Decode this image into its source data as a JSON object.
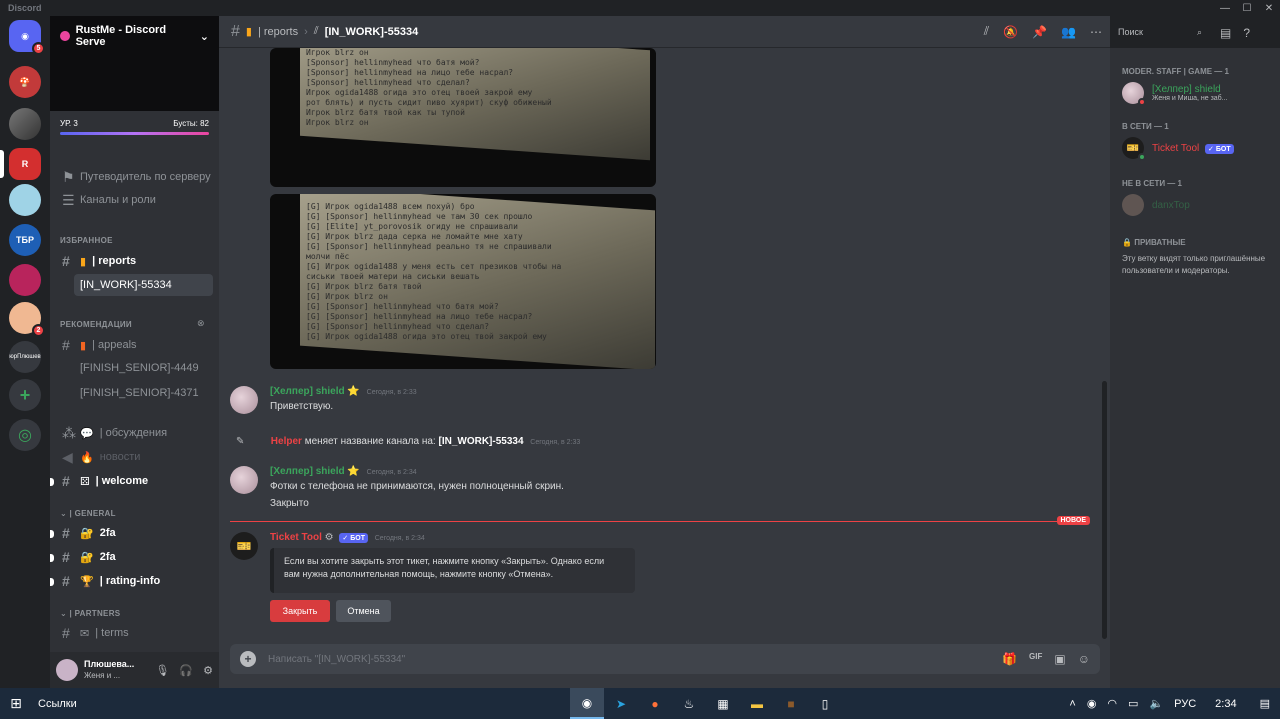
{
  "window": {
    "title": "Discord",
    "controls": [
      "—",
      "☐",
      "✕"
    ]
  },
  "rail": {
    "servers": [
      {
        "label": "⌂",
        "color": "#5865f2",
        "badge": "5"
      },
      {
        "label": "🍄",
        "color": "#c23a3a",
        "badge": ""
      },
      {
        "label": "",
        "color": "#5b5b5b",
        "badge": ""
      },
      {
        "label": "R",
        "color": "#d32f2f",
        "badge": ""
      },
      {
        "label": "",
        "color": "#9fd3e6",
        "badge": ""
      },
      {
        "label": "ТБР",
        "color": "#1e5fb5",
        "badge": ""
      },
      {
        "label": "",
        "color": "#b8245c",
        "badge": ""
      },
      {
        "label": "",
        "color": "#f0b892",
        "badge": "2"
      },
      {
        "label": "юрПлюшев",
        "color": "#36393f",
        "badge": ""
      }
    ],
    "add": "+",
    "explore": "◎"
  },
  "sidebar": {
    "server_name": "RustMe - Discord Serve",
    "level": "УР. 3",
    "boosts": "Бусты: 82",
    "guide": "Путеводитель по серверу",
    "channels_roles": "Каналы и роли",
    "cat_favorites": "ИЗБРАННОЕ",
    "reports": "| reports",
    "thread": "[IN_WORK]-55334",
    "cat_reco": "РЕКОМЕНДАЦИИ",
    "appeals": "| appeals",
    "finish1": "[FINISH_SENIOR]-4449",
    "finish2": "[FINISH_SENIOR]-4371",
    "discussions": "| обсуждения",
    "news": "новости",
    "welcome": "| welcome",
    "cat_general": "| GENERAL",
    "twofa1": "2fa",
    "twofa2": "2fa",
    "rating": "| rating-info",
    "cat_partners": "| PARTNERS",
    "terms": "| terms",
    "user_name": "Плюшева...",
    "user_status": "Женя и ..."
  },
  "topbar": {
    "crumb": "| reports",
    "thread": "[IN_WORK]-55334",
    "search": "Поиск"
  },
  "messages": {
    "m1_user": "[Хелпер] shield",
    "m1_time": "Сегодня, в 2:33",
    "m1_text": "Приветствую.",
    "sys_user": "Helper",
    "sys_text": "меняет название канала на:",
    "sys_name": "[IN_WORK]-55334",
    "sys_time": "Сегодня, в 2:33",
    "m2_user": "[Хелпер] shield",
    "m2_time": "Сегодня, в 2:34",
    "m2_text1": "Фотки с телефона не принимаются, нужен полноценный скрин.",
    "m2_text2": "Закрыто",
    "new_tag": "НОВОЕ",
    "bot_user": "Ticket Tool",
    "bot_badge": "✓ БОТ",
    "bot_time": "Сегодня, в 2:34",
    "embed_line1": "Если вы хотите закрыть этот тикет, нажмите кнопку «Закрыть». Однако если",
    "embed_line2": "вам нужна дополнительная помощь, нажмите кнопку «Отмена».",
    "btn_close": "Закрыть",
    "btn_cancel": "Отмена"
  },
  "photo1_lines": [
    "Игрок  blrz    он",
    "[Sponsor] hellinmyhead    что батя мой?",
    "[Sponsor] hellinmyhead    на лицо тебе насрал?",
    "[Sponsor] hellinmyhead    что сделал?",
    "Игрок  ogida1488    огида это отец твоей закрой ему",
    "рот блять) и пусть сидит пиво хуярит) скуф обиженый",
    "Игрок  blrz    батя твой как ты тупой",
    "Игрок  blrz    он"
  ],
  "photo2_lines": [
    "[G]  Игрок  ogida1488    всем похуй) бро",
    "[G]  [Sponsor] hellinmyhead    че там 30 сек прошло",
    "[G]  [Elite] yt_porovosik    огиду не спрашивали",
    "[G]  Игрок  blrz    дада серка не ломайте мне хату",
    "[G]  [Sponsor] hellinmyhead    реально тя не спрашивали",
    "молчи пёс",
    "[G]  Игрок  ogida1488    у меня есть сет презиков чтобы на",
    "сиськи твоей матери на сиськи вешать",
    "[G]  Игрок  blrz    батя твой",
    "[G]  Игрок  blrz    он",
    "[G]  [Sponsor] hellinmyhead    что батя мой?",
    "[G]  [Sponsor] hellinmyhead    на лицо тебе насрал?",
    "[G]  [Sponsor] hellinmyhead    что сделал?",
    "[G]  Игрок  ogida1488    огида это отец твой закрой ему"
  ],
  "composer": {
    "placeholder": "Написать \"[IN_WORK]-55334\""
  },
  "members": {
    "cat1": "MODER. STAFF | GAME — 1",
    "m1_name": "[Хелпер] shield",
    "m1_sub": "Женя и Миша, не заб...",
    "cat2": "В СЕТИ — 1",
    "m2_name": "Ticket Tool",
    "m2_badge": "✓ БОТ",
    "cat3": "НЕ В СЕТИ — 1",
    "m3_name": "danxTop",
    "private_title": "ПРИВАТНЫЕ",
    "private_text": "Эту ветку видят только приглашённые пользователи и модераторы."
  },
  "taskbar": {
    "label": "Ссылки",
    "lang": "РУС",
    "time": "2:34"
  },
  "colors": {
    "accent": "#5865f2",
    "danger": "#ed4245",
    "online": "#3ba55c"
  }
}
